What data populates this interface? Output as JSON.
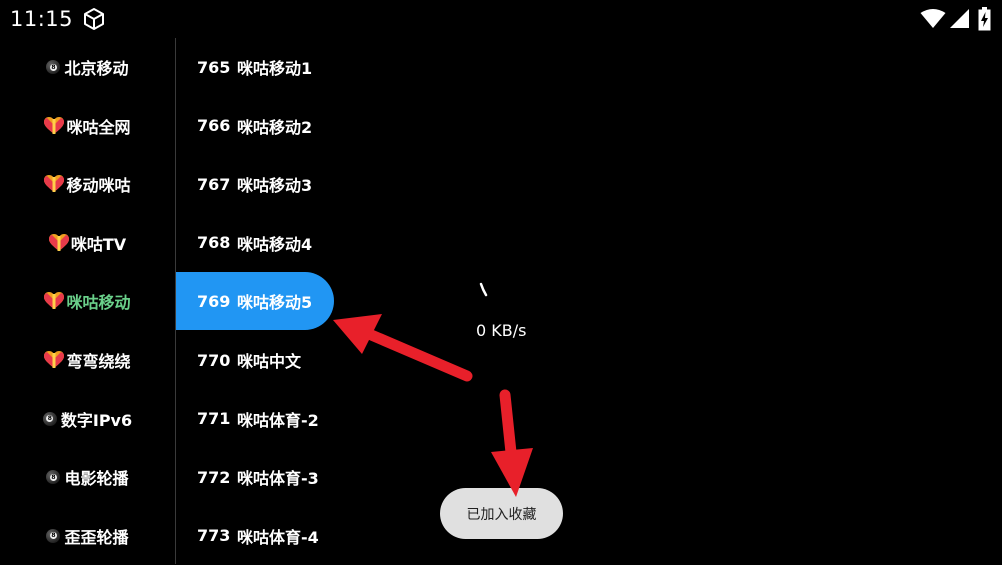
{
  "status_bar": {
    "time": "11:15",
    "icons": [
      "app-box-icon",
      "wifi-icon",
      "signal-icon",
      "battery-charging-icon"
    ]
  },
  "categories": [
    {
      "label": "北京移动",
      "icon": "ball-icon",
      "active": false
    },
    {
      "label": "咪咕全网",
      "icon": "heart-gift-icon",
      "active": false
    },
    {
      "label": "移动咪咕",
      "icon": "heart-gift-icon",
      "active": false
    },
    {
      "label": "咪咕TV",
      "icon": "heart-gift-icon",
      "active": false
    },
    {
      "label": "咪咕移动",
      "icon": "heart-gift-icon",
      "active": true
    },
    {
      "label": "弯弯绕绕",
      "icon": "heart-gift-icon",
      "active": false
    },
    {
      "label": "数字IPv6",
      "icon": "ball-icon",
      "active": false
    },
    {
      "label": "电影轮播",
      "icon": "ball-icon",
      "active": false
    },
    {
      "label": "歪歪轮播",
      "icon": "ball-icon",
      "active": false
    }
  ],
  "channels": [
    {
      "number": "765",
      "name": "咪咕移动1",
      "selected": false
    },
    {
      "number": "766",
      "name": "咪咕移动2",
      "selected": false
    },
    {
      "number": "767",
      "name": "咪咕移动3",
      "selected": false
    },
    {
      "number": "768",
      "name": "咪咕移动4",
      "selected": false
    },
    {
      "number": "769",
      "name": "咪咕移动5",
      "selected": true
    },
    {
      "number": "770",
      "name": "咪咕中文",
      "selected": false
    },
    {
      "number": "771",
      "name": "咪咕体育-2",
      "selected": false
    },
    {
      "number": "772",
      "name": "咪咕体育-3",
      "selected": false
    },
    {
      "number": "773",
      "name": "咪咕体育-4",
      "selected": false
    }
  ],
  "player": {
    "speed": "0 KB/s"
  },
  "toast": {
    "message": "已加入收藏"
  },
  "colors": {
    "selected_channel_bg": "#2196f3",
    "active_category_text": "#6ad08a",
    "annotation_arrow": "#e8202a",
    "toast_bg": "#e0e0e0"
  }
}
